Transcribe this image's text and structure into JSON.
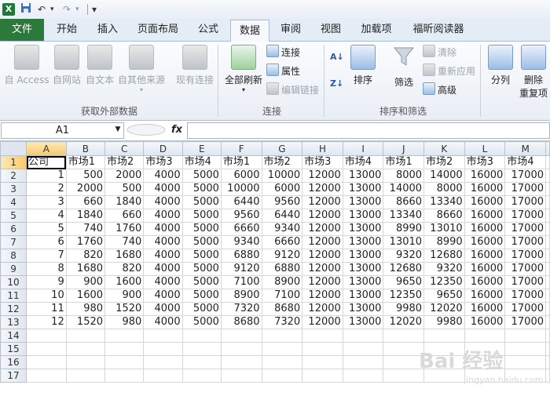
{
  "qat": {
    "undo": "↶",
    "redo": "↷",
    "customize": "▾"
  },
  "tabs": [
    {
      "label": "文件"
    },
    {
      "label": "开始"
    },
    {
      "label": "插入"
    },
    {
      "label": "页面布局"
    },
    {
      "label": "公式"
    },
    {
      "label": "数据"
    },
    {
      "label": "审阅"
    },
    {
      "label": "视图"
    },
    {
      "label": "加载项"
    },
    {
      "label": "福昕阅读器"
    }
  ],
  "ribbon": {
    "group_external": {
      "label": "获取外部数据",
      "from_access": "自 Access",
      "from_web": "自网站",
      "from_text": "自文本",
      "from_other": "自其他来源",
      "existing": "现有连接"
    },
    "group_connections": {
      "label": "连接",
      "refresh_all": "全部刷新",
      "connections": "连接",
      "properties": "属性",
      "edit_links": "编辑链接"
    },
    "group_sort": {
      "label": "排序和筛选",
      "sort": "排序",
      "filter": "筛选",
      "clear": "清除",
      "reapply": "重新应用",
      "advanced": "高级"
    },
    "group_tools": {
      "split": "分列",
      "remove_dup_1": "删除",
      "remove_dup_2": "重复项"
    }
  },
  "formula_bar": {
    "name_box": "A1",
    "fx": "fx",
    "formula": ""
  },
  "columns": [
    "A",
    "B",
    "C",
    "D",
    "E",
    "F",
    "G",
    "H",
    "I",
    "J",
    "K",
    "L",
    "M"
  ],
  "rows": [
    [
      "公司",
      "市场1",
      "市场2",
      "市场3",
      "市场4",
      "市场1",
      "市场2",
      "市场3",
      "市场4",
      "市场1",
      "市场2",
      "市场3",
      "市场4"
    ],
    [
      "1",
      "500",
      "2000",
      "4000",
      "5000",
      "6000",
      "10000",
      "12000",
      "13000",
      "8000",
      "14000",
      "16000",
      "17000"
    ],
    [
      "2",
      "2000",
      "500",
      "4000",
      "5000",
      "10000",
      "6000",
      "12000",
      "13000",
      "14000",
      "8000",
      "16000",
      "17000"
    ],
    [
      "3",
      "660",
      "1840",
      "4000",
      "5000",
      "6440",
      "9560",
      "12000",
      "13000",
      "8660",
      "13340",
      "16000",
      "17000"
    ],
    [
      "4",
      "1840",
      "660",
      "4000",
      "5000",
      "9560",
      "6440",
      "12000",
      "13000",
      "13340",
      "8660",
      "16000",
      "17000"
    ],
    [
      "5",
      "740",
      "1760",
      "4000",
      "5000",
      "6660",
      "9340",
      "12000",
      "13000",
      "8990",
      "13010",
      "16000",
      "17000"
    ],
    [
      "6",
      "1760",
      "740",
      "4000",
      "5000",
      "9340",
      "6660",
      "12000",
      "13000",
      "13010",
      "8990",
      "16000",
      "17000"
    ],
    [
      "7",
      "820",
      "1680",
      "4000",
      "5000",
      "6880",
      "9120",
      "12000",
      "13000",
      "9320",
      "12680",
      "16000",
      "17000"
    ],
    [
      "8",
      "1680",
      "820",
      "4000",
      "5000",
      "9120",
      "6880",
      "12000",
      "13000",
      "12680",
      "9320",
      "16000",
      "17000"
    ],
    [
      "9",
      "900",
      "1600",
      "4000",
      "5000",
      "7100",
      "8900",
      "12000",
      "13000",
      "9650",
      "12350",
      "16000",
      "17000"
    ],
    [
      "10",
      "1600",
      "900",
      "4000",
      "5000",
      "8900",
      "7100",
      "12000",
      "13000",
      "12350",
      "9650",
      "16000",
      "17000"
    ],
    [
      "11",
      "980",
      "1520",
      "4000",
      "5000",
      "7320",
      "8680",
      "12000",
      "13000",
      "9980",
      "12020",
      "16000",
      "17000"
    ],
    [
      "12",
      "1520",
      "980",
      "4000",
      "5000",
      "8680",
      "7320",
      "12000",
      "13000",
      "12020",
      "9980",
      "16000",
      "17000"
    ],
    [
      "",
      "",
      "",
      "",
      "",
      "",
      "",
      "",
      "",
      "",
      "",
      "",
      ""
    ],
    [
      "",
      "",
      "",
      "",
      "",
      "",
      "",
      "",
      "",
      "",
      "",
      "",
      ""
    ],
    [
      "",
      "",
      "",
      "",
      "",
      "",
      "",
      "",
      "",
      "",
      "",
      "",
      ""
    ],
    [
      "",
      "",
      "",
      "",
      "",
      "",
      "",
      "",
      "",
      "",
      "",
      "",
      ""
    ]
  ],
  "watermark": {
    "main": "Bai 经验",
    "sub": "jingyan.baidu.com"
  }
}
